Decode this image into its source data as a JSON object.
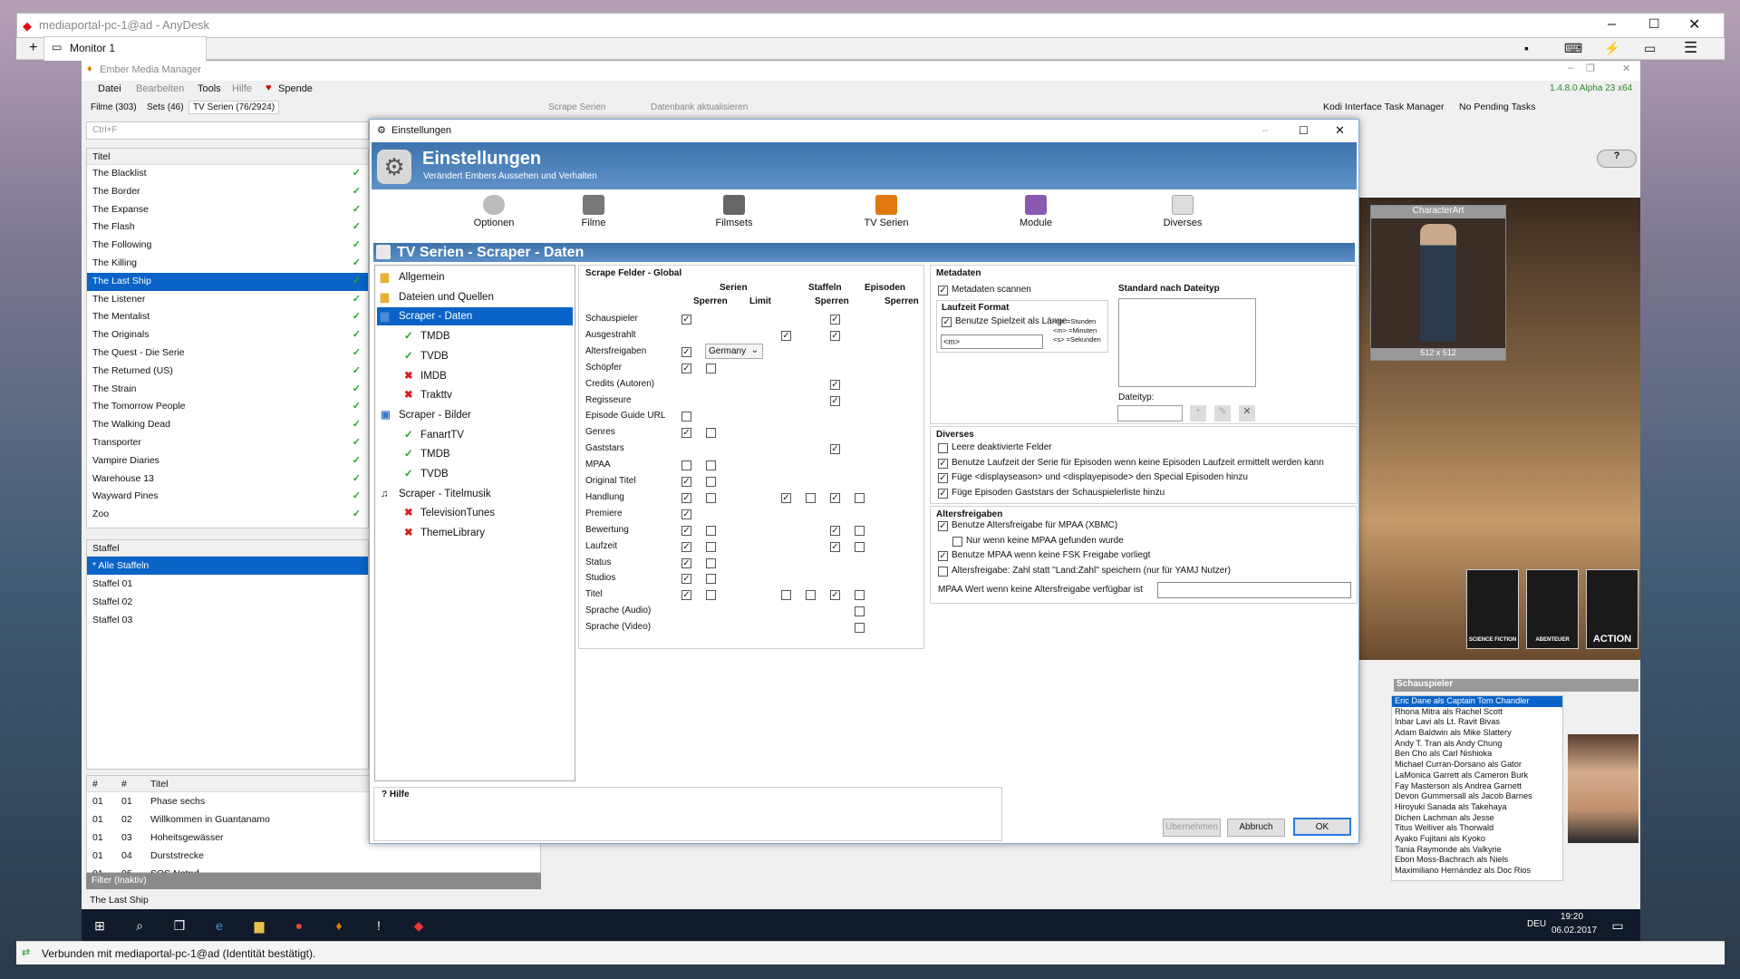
{
  "anydesk": {
    "title": "mediaportal-pc-1@ad - AnyDesk",
    "tab": "Monitor 1",
    "status": "Verbunden mit mediaportal-pc-1@ad (Identität bestätigt)."
  },
  "emm": {
    "title": "Ember Media Manager",
    "version": "1.4.8.0 Alpha 23 x64",
    "menu": [
      "Datei",
      "Bearbeiten",
      "Tools",
      "Hilfe",
      "Spende"
    ],
    "tabs": [
      "Filme (303)",
      "Sets (46)",
      "TV Serien (76/2924)"
    ],
    "toolbar": {
      "scrape": "Scrape Serien",
      "db": "Datenbank aktualisieren",
      "kodi": "Kodi Interface Task Manager",
      "pending": "No Pending Tasks"
    },
    "search_placeholder": "Ctrl+F",
    "list_header": "Titel",
    "shows": [
      "The Blacklist",
      "The Border",
      "The Expanse",
      "The Flash",
      "The Following",
      "The Killing",
      "The Last Ship",
      "The Listener",
      "The Mentalist",
      "The Originals",
      "The Quest - Die Serie",
      "The Returned (US)",
      "The Strain",
      "The Tomorrow People",
      "The Walking Dead",
      "Transporter",
      "Vampire Diaries",
      "Warehouse 13",
      "Wayward Pines",
      "Zoo"
    ],
    "selected_show": 6,
    "season_header": "Staffel",
    "seasons": [
      "* Alle Staffeln",
      "Staffel 01",
      "Staffel 02",
      "Staffel 03"
    ],
    "ep_headers": [
      "#",
      "#",
      "Titel"
    ],
    "episodes": [
      {
        "s": "01",
        "e": "01",
        "t": "Phase sechs"
      },
      {
        "s": "01",
        "e": "02",
        "t": "Willkommen in Guantanamo"
      },
      {
        "s": "01",
        "e": "03",
        "t": "Hoheitsgewässer"
      },
      {
        "s": "01",
        "e": "04",
        "t": "Durststrecke"
      },
      {
        "s": "01",
        "e": "05",
        "t": "SOS Notruf"
      }
    ],
    "filter": "Filter (Inaktiv)",
    "footer_title": "The Last Ship",
    "characterart_label": "CharacterArt",
    "characterart_size": "512 x 512",
    "genre_tiles": [
      "SCIENCE FICTION",
      "ABENTEUER",
      "ACTION"
    ],
    "actors_header": "Schauspieler",
    "actors": [
      "Eric Dane als Captain Tom Chandler",
      "Rhona Mitra als Rachel Scott",
      "Inbar Lavi als Lt. Ravit Bivas",
      "Adam Baldwin als Mike Slattery",
      "Andy T. Tran als Andy Chung",
      "Ben Cho als Carl Nishioka",
      "Michael Curran-Dorsano als Gator",
      "LaMonica Garrett als Cameron Burk",
      "Fay Masterson als Andrea Garnett",
      "Devon Gummersall als Jacob Barnes",
      "Hiroyuki Sanada als Takehaya",
      "Dichen Lachman als Jesse",
      "Titus Welliver als Thorwald",
      "Ayako Fujitani als Kyoko",
      "Tania Raymonde als Valkyrie",
      "Ebon Moss-Bachrach als Niels",
      "Maximiliano Hernández als Doc Rios"
    ]
  },
  "dialog": {
    "title": "Einstellungen",
    "banner_title": "Einstellungen",
    "banner_sub": "Verändert Embers Aussehen und Verhalten",
    "tools": [
      "Optionen",
      "Filme",
      "Filmsets",
      "TV Serien",
      "Module",
      "Diverses"
    ],
    "section": "TV Serien - Scraper - Daten",
    "tree": [
      {
        "label": "Allgemein",
        "status": "folder"
      },
      {
        "label": "Dateien und Quellen",
        "status": "folder"
      },
      {
        "label": "Scraper - Daten",
        "status": "sel"
      },
      {
        "label": "TMDB",
        "status": "ok"
      },
      {
        "label": "TVDB",
        "status": "ok"
      },
      {
        "label": "IMDB",
        "status": "x"
      },
      {
        "label": "Trakttv",
        "status": "x"
      },
      {
        "label": "Scraper - Bilder",
        "status": "img"
      },
      {
        "label": "FanartTV",
        "status": "ok"
      },
      {
        "label": "TMDB",
        "status": "ok"
      },
      {
        "label": "TVDB",
        "status": "ok"
      },
      {
        "label": "Scraper - Titelmusik",
        "status": "music"
      },
      {
        "label": "TelevisionTunes",
        "status": "x"
      },
      {
        "label": "ThemeLibrary",
        "status": "x"
      }
    ],
    "scrape_group": "Scrape Felder - Global",
    "col_groups": [
      "Serien",
      "Staffeln",
      "Episoden"
    ],
    "col_sub": [
      "Sperren",
      "Limit",
      "Sperren",
      "Sperren"
    ],
    "fields": [
      "Schauspieler",
      "Ausgestrahlt",
      "Altersfreigaben",
      "Schöpfer",
      "Credits (Autoren)",
      "Regisseure",
      "Episode Guide URL",
      "Genres",
      "Gaststars",
      "MPAA",
      "Original Titel",
      "Handlung",
      "Premiere",
      "Bewertung",
      "Laufzeit",
      "Status",
      "Studios",
      "Titel",
      "Sprache (Audio)",
      "Sprache (Video)"
    ],
    "country": "Germany",
    "metadaten_group": "Metadaten",
    "metadaten_scan": "Metadaten scannen",
    "laufzeit_group": "Laufzeit Format",
    "laufzeit_check": "Benutze Spielzeit als Länge",
    "laufzeit_value": "<m>",
    "laufzeit_help": [
      "<h> =Stunden",
      "<m> =Minuten",
      "<s> =Sekunden"
    ],
    "dateityp_group": "Standard nach Dateityp",
    "dateityp_label": "Dateityp:",
    "diverses_group": "Diverses",
    "diverses": [
      "Leere deaktivierte Felder",
      "Benutze Laufzeit der Serie für Episoden wenn keine Episoden Laufzeit ermittelt werden kann",
      "Füge <displayseason> und <displayepisode> den Special Episoden hinzu",
      "Füge Episoden Gaststars der Schauspielerliste hinzu"
    ],
    "alters_group": "Altersfreigaben",
    "alters": [
      "Benutze Altersfreigabe für MPAA (XBMC)",
      "Nur wenn keine MPAA gefunden wurde",
      "Benutze MPAA wenn keine FSK Freigabe vorliegt",
      "Altersfreigabe: Zahl statt \"Land:Zahl\" speichern (nur für YAMJ Nutzer)"
    ],
    "mpaa_label": "MPAA Wert wenn keine Altersfreigabe verfügbar ist",
    "hilfe": "Hilfe",
    "buttons": {
      "apply": "Übernehmen",
      "cancel": "Abbruch",
      "ok": "OK"
    }
  },
  "taskbar": {
    "lang": "DEU",
    "time": "19:20",
    "date": "06.02.2017"
  }
}
